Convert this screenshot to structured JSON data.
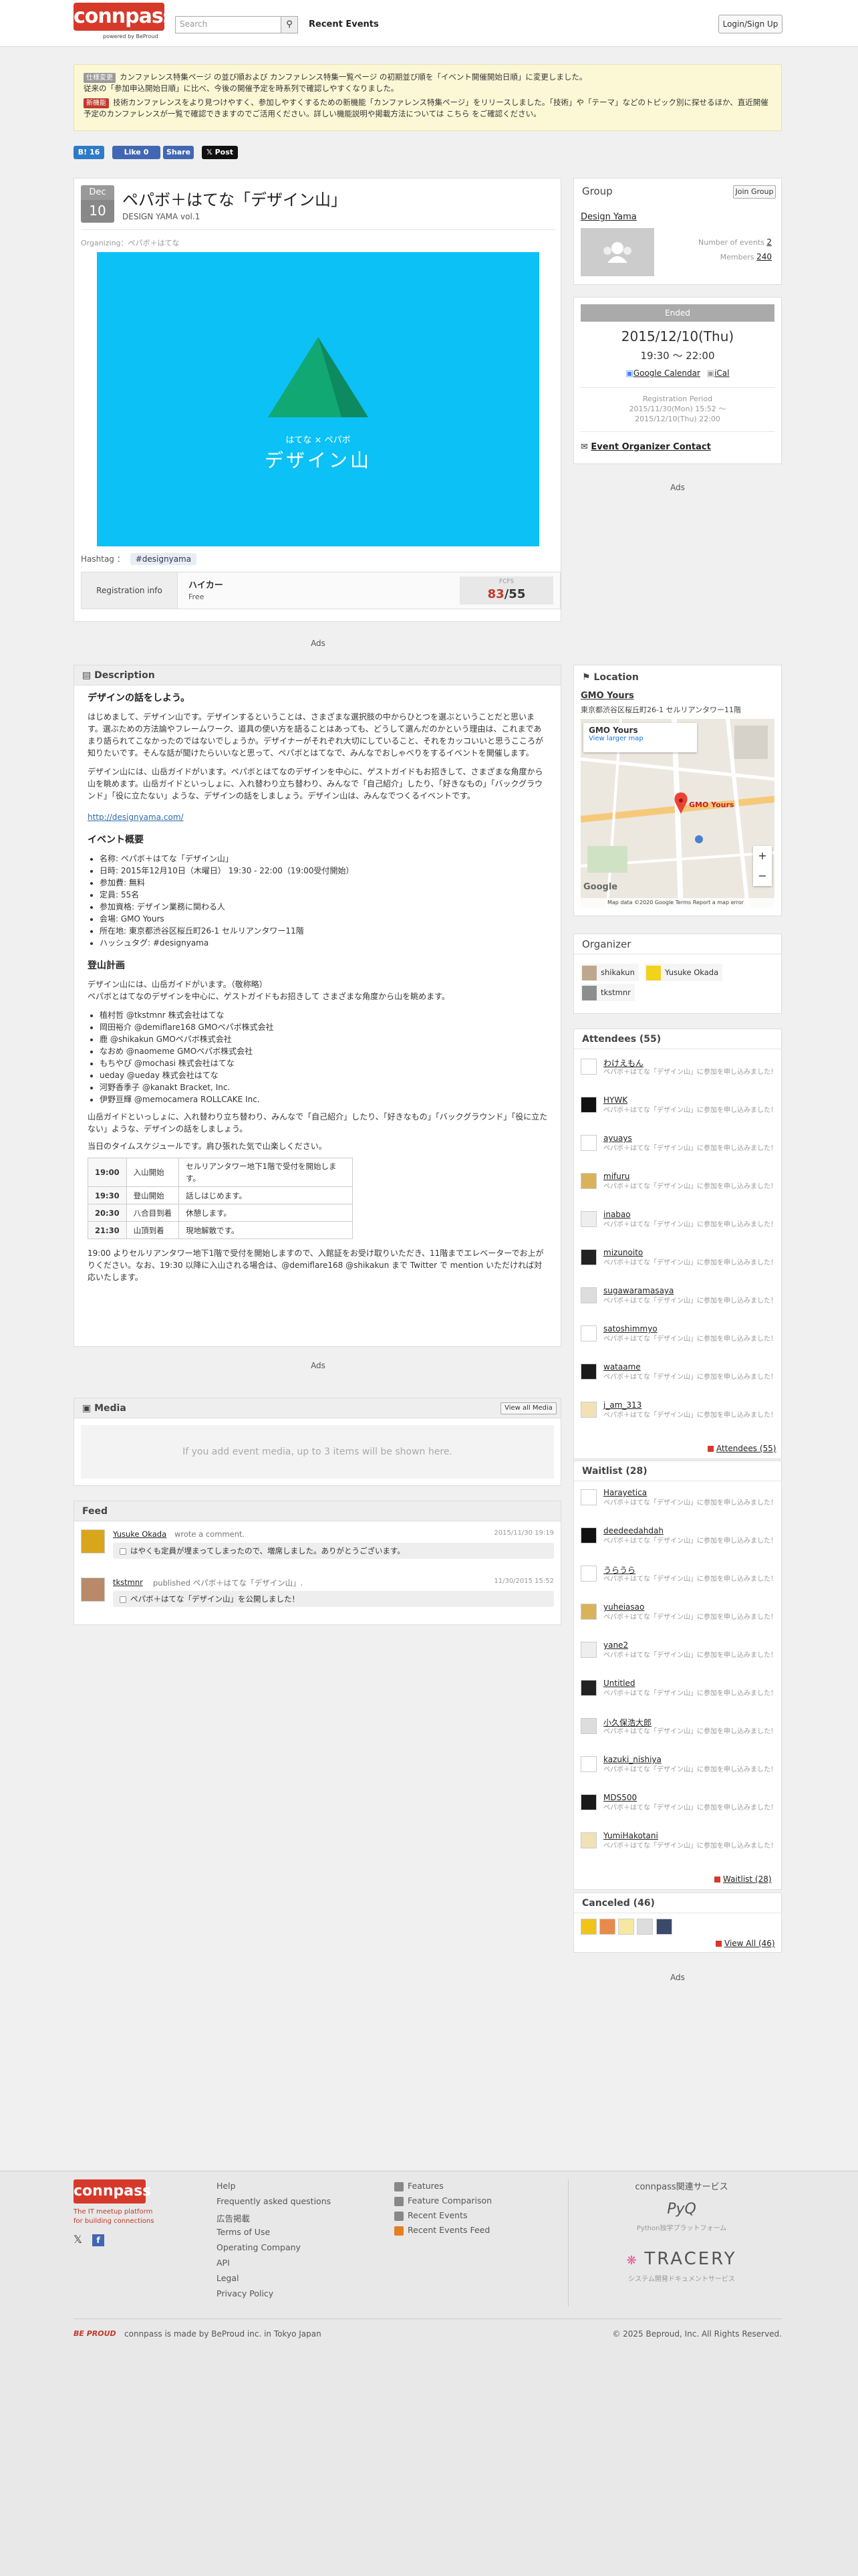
{
  "header": {
    "logo_text": "connpass",
    "powered_by": "powered by BeProud",
    "search_placeholder": "Search",
    "recent_events": "Recent Events",
    "login_signup": "Login/Sign Up"
  },
  "notice": {
    "tag1": "仕様変更",
    "line1": "カンファレンス特集ページ の並び順および カンファレンス特集一覧ページ の初期並び順を「イベント開催開始日順」に変更しました。",
    "line1b": "従来の「参加申込開始日順」に比べ、今後の開催予定を時系列で確認しやすくなりました。",
    "tag2": "新機能",
    "line2": "技術カンファレンスをより見つけやすく、参加しやすくするための新機能「カンファレンス特集ページ」をリリースしました。「技術」や「テーマ」などのトピック別に探せるほか、直近開催予定のカンファレンスが一覧で確認できますのでご活用ください。詳しい機能説明や掲載方法については こちら をご確認ください。",
    "tag1_color": "#9a9a9a",
    "tag2_color": "#c0392b"
  },
  "social": {
    "bookmark_count": "16",
    "like_label": "Like 0",
    "share_label": "Share",
    "post_label": "Post"
  },
  "event": {
    "month": "Dec",
    "day": "10",
    "title": "ペパボ＋はてな「デザイン山」",
    "subtitle": "DESIGN YAMA vol.1",
    "organizing": "Organizing：ペパボ＋はてな",
    "hero_small": "はてな × ペパボ",
    "hero_big": "デザイン山",
    "hashtag_label": "Hashtag ：",
    "hashtag": "#designyama",
    "registration_label": "Registration info",
    "reg_type": "ハイカー",
    "reg_fee": "Free",
    "fcfs_label": "FCFS",
    "attendees_count": "83",
    "capacity": "/55",
    "ads": "Ads"
  },
  "description": {
    "header": "Description",
    "h1": "デザインの話をしよう。",
    "p1": "はじめまして、デザイン山です。デザインするということは、さまざまな選択肢の中からひとつを選ぶということだと思います。選ぶための方法論やフレームワーク、道具の使い方を語ることはあっても、どうして選んだのかという理由は、これまであまり語られてこなかったのではないでしょうか。デザイナーがそれぞれ大切にしていること、それをカッコいいと思うこころが知りたいです。そんな話が聞けたらいいなと思って、ペパボとはてなで、みんなでおしゃべりをするイベントを開催します。",
    "p2": "デザイン山には、山岳ガイドがいます。ペパボとはてなのデザインを中心に、ゲストガイドもお招きして、さまざまな角度から山を眺めます。山岳ガイドといっしょに、入れ替わり立ち替わり、みんなで「自己紹介」したり、「好きなもの」「バックグラウンド」「役に立たない」ような、デザインの話をしましょう。デザイン山は、みんなでつくるイベントです。",
    "url": "http://designyama.com/",
    "h2": "イベント概要",
    "summary": [
      "名称: ペパボ＋はてな「デザイン山」",
      "日時: 2015年12月10日（木曜日） 19:30 - 22:00（19:00受付開始）",
      "参加費: 無料",
      "定員: 55名",
      "参加資格: デザイン業務に関わる人",
      "会場: GMO Yours",
      "所在地: 東京都渋谷区桜丘町26-1 セルリアンタワー11階",
      "ハッシュタグ: #designyama"
    ],
    "h3": "登山計画",
    "p3": "デザイン山には、山岳ガイドがいます。（敬称略）",
    "p3b": "ペパボとはてなのデザインを中心に、ゲストガイドもお招きして さまざまな角度から山を眺めます。",
    "guides": [
      "植村哲 @tkstmnr 株式会社はてな",
      "岡田裕介 @demiflare168 GMOペパボ株式会社",
      "鹿 @shikakun GMOペパボ株式会社",
      "なおめ @naomeme GMOペパボ株式会社",
      "もちやぴ @mochasi 株式会社はてな",
      "ueday @ueday 株式会社はてな",
      "河野香季子 @kanakt Bracket, Inc.",
      "伊野亘輝 @memocamera ROLLCAKE Inc."
    ],
    "p4": "山岳ガイドといっしょに、入れ替わり立ち替わり、みんなで「自己紹介」したり、「好きなもの」「バックグラウンド」「役に立たない」ような、デザインの話をしましょう。",
    "p5": "当日のタイムスケジュールです。肩ひ張れた気で山楽しください。",
    "schedule": [
      {
        "time": "19:00",
        "name": "入山開始",
        "note": "セルリアンタワー地下1階で受付を開始します。"
      },
      {
        "time": "19:30",
        "name": "登山開始",
        "note": "話しはじめます。"
      },
      {
        "time": "20:30",
        "name": "八合目到着",
        "note": "休憩します。"
      },
      {
        "time": "21:30",
        "name": "山頂到着",
        "note": "現地解散です。"
      }
    ],
    "p6": "19:00 よりセルリアンタワー地下1階で受付を開始しますので、入館証をお受け取りいただき、11階までエレベーターでお上がりください。なお、19:30 以降に入山される場合は、@demiflare168 @shikakun まで Twitter で mention いただければ対応いたします。"
  },
  "media": {
    "header": "Media",
    "view_all": "View all Media",
    "empty": "If you add event media, up to 3 items will be shown here."
  },
  "feed": {
    "header": "Feed",
    "items": [
      {
        "user": "Yusuke Okada",
        "action": "wrote a comment.",
        "time": "2015/11/30 19:19",
        "body": "はやくも定員が埋まってしまったので、増席しました。ありがとうございます。"
      },
      {
        "user": "tkstmnr",
        "action": "published ペパボ＋はてな「デザイン山」.",
        "time": "11/30/2015 15:52",
        "body": "ペパボ＋はてな「デザイン山」を公開しました！"
      }
    ]
  },
  "group": {
    "header": "Group",
    "join": "Join Group",
    "name": "Design Yama",
    "events_label": "Number of events",
    "events": "2",
    "members_label": "Members",
    "members": "240"
  },
  "status": {
    "ended": "Ended",
    "date": "2015/12/10(Thu)",
    "time": "19:30 〜 22:00",
    "gcal": "Google Calendar",
    "ical": "iCal",
    "period_label": "Registration Period",
    "period_start": "2015/11/30(Mon) 15:52 〜",
    "period_end": "2015/12/10(Thu) 22:00",
    "contact": "Event Organizer Contact",
    "ads": "Ads"
  },
  "location": {
    "header": "Location",
    "venue": "GMO Yours",
    "address": "東京都渋谷区桜丘町26-1 セルリアンタワー11階",
    "map_title": "GMO Yours",
    "map_link": "View larger map",
    "map_marker": "GMO Yours",
    "map_footer": "Map data ©2020 Google  Terms  Report a map error",
    "google": "Google"
  },
  "organizer": {
    "header": "Organizer",
    "people": [
      "shikakun",
      "Yusuke Okada",
      "tkstmnr"
    ]
  },
  "attendees": {
    "header": "Attendees (55)",
    "people": [
      {
        "name": "わけえもん",
        "comment": "ペパボ＋はてな「デザイン山」に参加を申し込みました！"
      },
      {
        "name": "HYWK",
        "comment": "ペパボ＋はてな「デザイン山」に参加を申し込みました！"
      },
      {
        "name": "ayuays",
        "comment": "ペパボ＋はてな「デザイン山」に参加を申し込みました！"
      },
      {
        "name": "mifuru",
        "comment": "ペパボ＋はてな「デザイン山」に参加を申し込みました！"
      },
      {
        "name": "inabao",
        "comment": "ペパボ＋はてな「デザイン山」に参加を申し込みました！"
      },
      {
        "name": "mizunoito",
        "comment": "ペパボ＋はてな「デザイン山」に参加を申し込みました！"
      },
      {
        "name": "sugawaramasaya",
        "comment": "ペパボ＋はてな「デザイン山」に参加を申し込みました！"
      },
      {
        "name": "satoshimmyo",
        "comment": "ペパボ＋はてな「デザイン山」に参加を申し込みました！"
      },
      {
        "name": "wataame",
        "comment": "ペパボ＋はてな「デザイン山」に参加を申し込みました！"
      },
      {
        "name": "j_am_313",
        "comment": "ペパボ＋はてな「デザイン山」に参加を申し込みました！"
      }
    ],
    "more": "Attendees (55)"
  },
  "waitlist": {
    "header": "Waitlist (28)",
    "people": [
      {
        "name": "Harayetica",
        "comment": "ペパボ＋はてな「デザイン山」に参加を申し込みました！"
      },
      {
        "name": "deedeedahdah",
        "comment": "ペパボ＋はてな「デザイン山」に参加を申し込みました！"
      },
      {
        "name": "うらうら",
        "comment": "ペパボ＋はてな「デザイン山」に参加を申し込みました！"
      },
      {
        "name": "yuheiasao",
        "comment": "ペパボ＋はてな「デザイン山」に参加を申し込みました！"
      },
      {
        "name": "yane2",
        "comment": "ペパボ＋はてな「デザイン山」に参加を申し込みました！"
      },
      {
        "name": "Untitled",
        "comment": "ペパボ＋はてな「デザイン山」に参加を申し込みました！"
      },
      {
        "name": "小久保浩大郎",
        "comment": "ペパボ＋はてな「デザイン山」に参加を申し込みました！"
      },
      {
        "name": "kazuki_nishiya",
        "comment": "ペパボ＋はてな「デザイン山」に参加を申し込みました！"
      },
      {
        "name": "MDS500",
        "comment": "ペパボ＋はてな「デザイン山」に参加を申し込みました！"
      },
      {
        "name": "YumiHakotani",
        "comment": "ペパボ＋はてな「デザイン山」に参加を申し込みました！"
      }
    ],
    "more": "Waitlist (28)"
  },
  "canceled": {
    "header": "Canceled (46)",
    "more": "View All (46)"
  },
  "side_ads": "Ads",
  "footer": {
    "logo": "connpass",
    "tagline1": "The IT meetup platform",
    "tagline2": "for building connections",
    "links1": [
      "Help",
      "Frequently asked questions",
      "広告掲載",
      "Terms of Use",
      "Operating Company",
      "API",
      "Legal",
      "Privacy Policy"
    ],
    "links2": [
      "Features",
      "Feature Comparison",
      "Recent Events",
      "Recent Events Feed"
    ],
    "related_title": "connpass関連サービス",
    "pyq": "PyQ",
    "pyq_sub": "Python独学プラットフォーム",
    "tracery": "TRACERY",
    "tracery_sub": "システム開発ドキュメントサービス",
    "made_by": "connpass is made by BeProud inc. in Tokyo Japan",
    "beproud": "BE PROUD",
    "copyright": "© 2025 Beproud, Inc. All Rights Reserved."
  }
}
